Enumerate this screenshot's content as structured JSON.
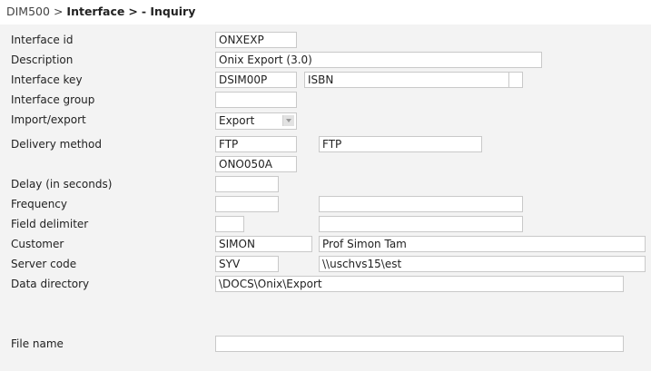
{
  "breadcrumb": {
    "part1": "DIM500",
    "sep1": ">",
    "part2": "Interface",
    "sep2": ">",
    "part3": "- Inquiry"
  },
  "fields": {
    "interface_id": {
      "label": "Interface id",
      "value": "ONXEXP"
    },
    "description": {
      "label": "Description",
      "value": "Onix Export (3.0)"
    },
    "interface_key": {
      "label": "Interface key",
      "value1": "DSIM00P",
      "value2": "ISBN",
      "value3": ""
    },
    "interface_group": {
      "label": "Interface group",
      "value": ""
    },
    "import_export": {
      "label": "Import/export",
      "value": "Export"
    },
    "delivery_method": {
      "label": "Delivery method",
      "value1": "FTP",
      "value2": "FTP",
      "value3": "ONO050A"
    },
    "delay": {
      "label": "Delay (in seconds)",
      "value": ""
    },
    "frequency": {
      "label": "Frequency",
      "value1": "",
      "value2": ""
    },
    "field_delimiter": {
      "label": "Field delimiter",
      "value1": "",
      "value2": ""
    },
    "customer": {
      "label": "Customer",
      "value1": "SIMON",
      "value2": "Prof Simon Tam"
    },
    "server_code": {
      "label": "Server code",
      "value1": "SYV",
      "value2": "\\\\uschvs15\\est"
    },
    "data_directory": {
      "label": "Data directory",
      "value": "\\DOCS\\Onix\\Export"
    },
    "file_name": {
      "label": "File name",
      "value": ""
    }
  },
  "icons": {
    "select_arrow": "chevron-down-icon"
  },
  "colors": {
    "panel_bg": "#f3f3f3",
    "field_border": "#c9c9c9",
    "text": "#222222"
  }
}
